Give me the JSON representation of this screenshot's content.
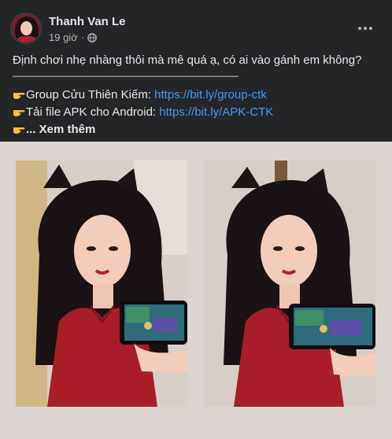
{
  "post": {
    "author": "Thanh Van Le",
    "time": "19 giờ",
    "time_separator": "·",
    "privacy_icon": "globe-icon",
    "more_icon": "more-options-icon",
    "caption": "Định chơi nhẹ nhàng thôi mà mê quá ạ, có ai vào gánh em không?",
    "divider": "——————————————————————————",
    "line1_label": "Group Cửu Thiên Kiếm: ",
    "line1_link": "https://bit.ly/group-ctk",
    "line2_label": "Tải file APK cho Android: ",
    "line2_link": "https://bit.ly/APK-CTK",
    "see_more_prefix": "... ",
    "see_more": "Xem thêm",
    "bullet_icon": "pointing-hand-icon"
  },
  "colors": {
    "background": "#242526",
    "text": "#e4e6eb",
    "secondary": "#b0b3b8",
    "link": "#4599ff",
    "media_background": "#dcd4d0"
  },
  "media": {
    "photos": [
      "photo-1",
      "photo-2"
    ]
  }
}
